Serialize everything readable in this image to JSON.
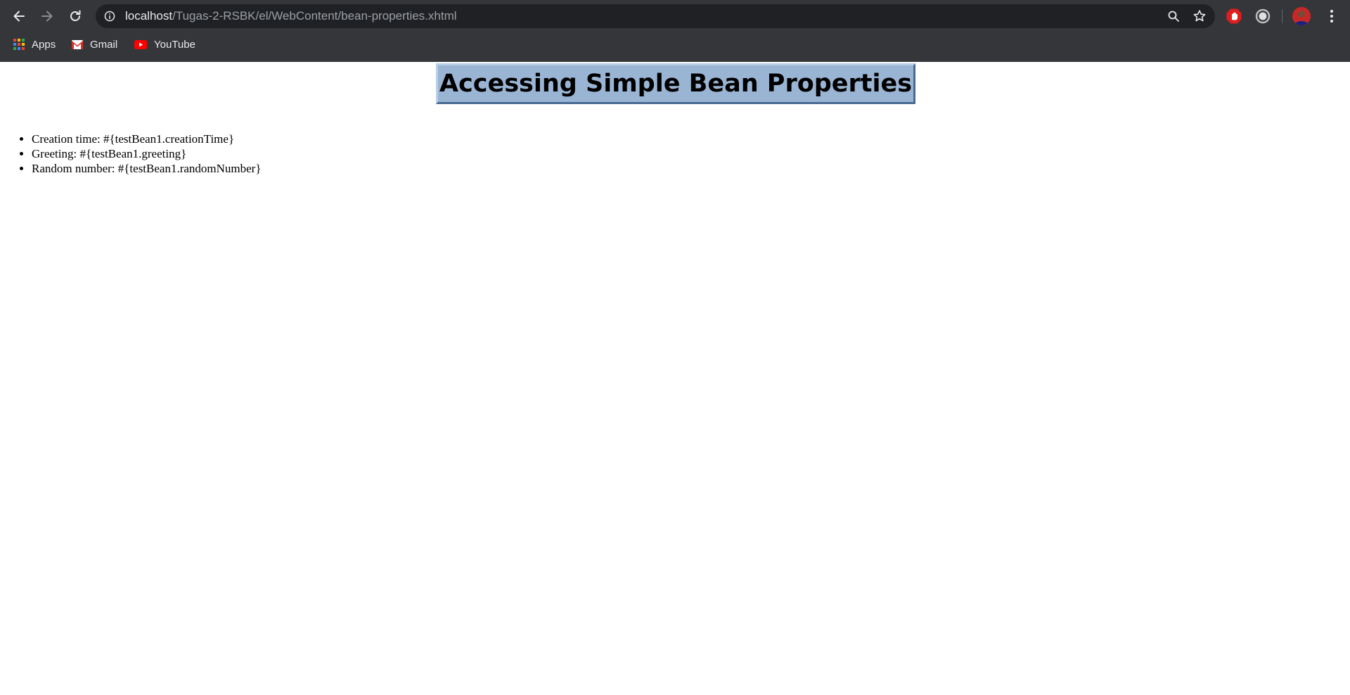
{
  "browser": {
    "url_host": "localhost",
    "url_path": "/Tugas-2-RSBK/el/WebContent/bean-properties.xhtml",
    "bookmarks": [
      {
        "label": "Apps",
        "icon": "apps-grid-icon"
      },
      {
        "label": "Gmail",
        "icon": "gmail-icon"
      },
      {
        "label": "YouTube",
        "icon": "youtube-icon"
      }
    ],
    "toolbar_icons": [
      "back-arrow-icon",
      "forward-arrow-icon",
      "reload-icon",
      "info-icon",
      "zoom-icon",
      "star-icon",
      "stop-extension-icon",
      "circle-extension-icon",
      "avatar",
      "menu-icon"
    ],
    "colors": {
      "chrome_bg": "#35363a",
      "omnibox_bg": "#202124",
      "text": "#e8eaed",
      "muted_text": "#9aa0a6"
    }
  },
  "page": {
    "title": "Accessing Simple Bean Properties",
    "title_bg": "#9ab5d4",
    "items": [
      "Creation time: #{testBean1.creationTime}",
      "Greeting: #{testBean1.greeting}",
      "Random number: #{testBean1.randomNumber}"
    ]
  }
}
